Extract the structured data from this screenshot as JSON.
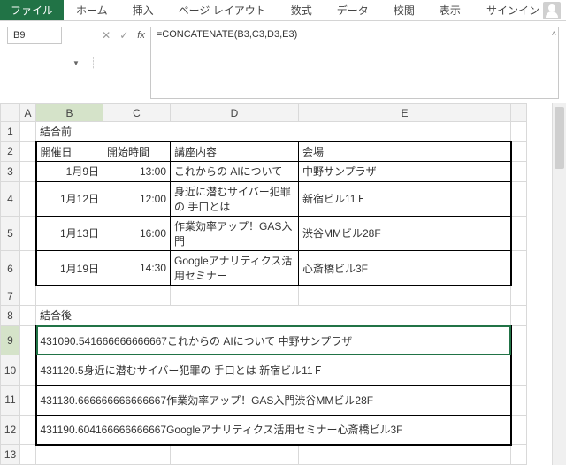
{
  "ribbon": {
    "file": "ファイル",
    "tabs": [
      "ホーム",
      "挿入",
      "ページ レイアウト",
      "数式",
      "データ",
      "校閲",
      "表示"
    ],
    "signin": "サインイン"
  },
  "namebox": "B9",
  "formula": "=CONCATENATE(B3,C3,D3,E3)",
  "labels": {
    "before": "結合前",
    "after": "結合後",
    "date": "開催日",
    "time": "開始時間",
    "topic": "講座内容",
    "venue": "会場"
  },
  "rows": [
    {
      "date": "1月9日",
      "time": "13:00",
      "topic": "これからの AIについて",
      "venue": "中野サンプラザ"
    },
    {
      "date": "1月12日",
      "time": "12:00",
      "topic": "身近に潜むサイバー犯罪の 手口とは",
      "venue": "新宿ビル11Ｆ"
    },
    {
      "date": "1月13日",
      "time": "16:00",
      "topic": "作業効率アップ！GAS入門",
      "venue": "渋谷MMビル28F"
    },
    {
      "date": "1月19日",
      "time": "14:30",
      "topic": "Googleアナリティクス活用セミナー",
      "venue": "心斎橋ビル3F"
    }
  ],
  "concat": [
    "431090.541666666666667これからの AIについて 中野サンプラザ",
    "431120.5身近に潜むサイバー犯罪の 手口とは 新宿ビル11Ｆ",
    "431130.666666666666667作業効率アップ！GAS入門渋谷MMビル28F",
    "431190.604166666666667Googleアナリティクス活用セミナー心斎橋ビル3F"
  ],
  "cols": [
    "A",
    "B",
    "C",
    "D",
    "E"
  ],
  "rownums": [
    "1",
    "2",
    "3",
    "4",
    "5",
    "6",
    "7",
    "8",
    "9",
    "10",
    "11",
    "12",
    "13"
  ]
}
